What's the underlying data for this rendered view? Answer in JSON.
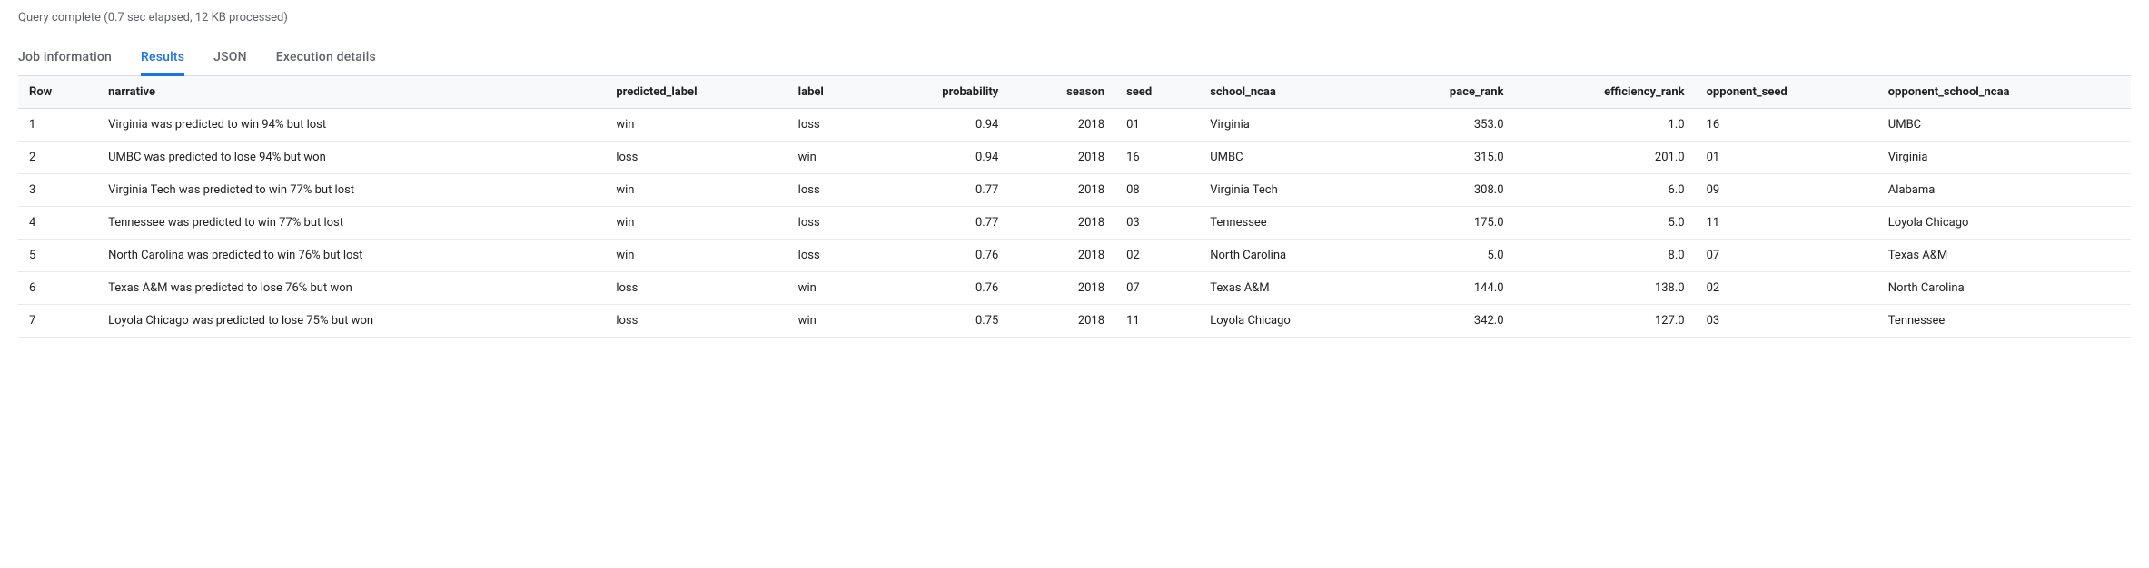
{
  "status": "Query complete (0.7 sec elapsed, 12 KB processed)",
  "tabs": {
    "job_information": "Job information",
    "results": "Results",
    "json": "JSON",
    "execution_details": "Execution details"
  },
  "table": {
    "headers": {
      "row": "Row",
      "narrative": "narrative",
      "predicted_label": "predicted_label",
      "label": "label",
      "probability": "probability",
      "season": "season",
      "seed": "seed",
      "school_ncaa": "school_ncaa",
      "pace_rank": "pace_rank",
      "efficiency_rank": "efficiency_rank",
      "opponent_seed": "opponent_seed",
      "opponent_school_ncaa": "opponent_school_ncaa"
    },
    "rows": [
      {
        "row": "1",
        "narrative": "Virginia was predicted to win 94% but lost",
        "predicted_label": "win",
        "label": "loss",
        "probability": "0.94",
        "season": "2018",
        "seed": "01",
        "school_ncaa": "Virginia",
        "pace_rank": "353.0",
        "efficiency_rank": "1.0",
        "opponent_seed": "16",
        "opponent_school_ncaa": "UMBC"
      },
      {
        "row": "2",
        "narrative": "UMBC was predicted to lose 94% but won",
        "predicted_label": "loss",
        "label": "win",
        "probability": "0.94",
        "season": "2018",
        "seed": "16",
        "school_ncaa": "UMBC",
        "pace_rank": "315.0",
        "efficiency_rank": "201.0",
        "opponent_seed": "01",
        "opponent_school_ncaa": "Virginia"
      },
      {
        "row": "3",
        "narrative": "Virginia Tech was predicted to win 77% but lost",
        "predicted_label": "win",
        "label": "loss",
        "probability": "0.77",
        "season": "2018",
        "seed": "08",
        "school_ncaa": "Virginia Tech",
        "pace_rank": "308.0",
        "efficiency_rank": "6.0",
        "opponent_seed": "09",
        "opponent_school_ncaa": "Alabama"
      },
      {
        "row": "4",
        "narrative": "Tennessee was predicted to win 77% but lost",
        "predicted_label": "win",
        "label": "loss",
        "probability": "0.77",
        "season": "2018",
        "seed": "03",
        "school_ncaa": "Tennessee",
        "pace_rank": "175.0",
        "efficiency_rank": "5.0",
        "opponent_seed": "11",
        "opponent_school_ncaa": "Loyola Chicago"
      },
      {
        "row": "5",
        "narrative": "North Carolina was predicted to win 76% but lost",
        "predicted_label": "win",
        "label": "loss",
        "probability": "0.76",
        "season": "2018",
        "seed": "02",
        "school_ncaa": "North Carolina",
        "pace_rank": "5.0",
        "efficiency_rank": "8.0",
        "opponent_seed": "07",
        "opponent_school_ncaa": "Texas A&M"
      },
      {
        "row": "6",
        "narrative": "Texas A&M was predicted to lose 76% but won",
        "predicted_label": "loss",
        "label": "win",
        "probability": "0.76",
        "season": "2018",
        "seed": "07",
        "school_ncaa": "Texas A&M",
        "pace_rank": "144.0",
        "efficiency_rank": "138.0",
        "opponent_seed": "02",
        "opponent_school_ncaa": "North Carolina"
      },
      {
        "row": "7",
        "narrative": "Loyola Chicago was predicted to lose 75% but won",
        "predicted_label": "loss",
        "label": "win",
        "probability": "0.75",
        "season": "2018",
        "seed": "11",
        "school_ncaa": "Loyola Chicago",
        "pace_rank": "342.0",
        "efficiency_rank": "127.0",
        "opponent_seed": "03",
        "opponent_school_ncaa": "Tennessee"
      }
    ]
  }
}
